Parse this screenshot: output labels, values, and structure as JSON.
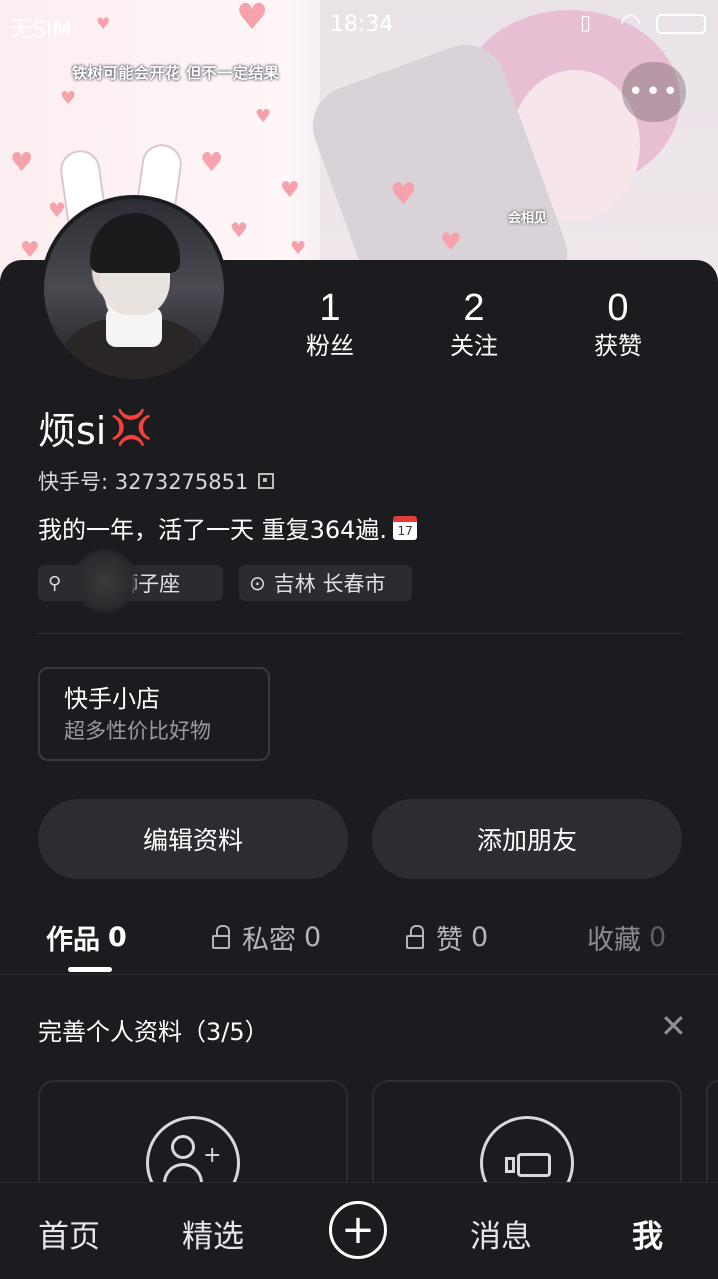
{
  "status_bar": {
    "carrier": "无SIM",
    "time": "18:34"
  },
  "banner": {
    "lyric": "铁树可能会开花 但不一定结果",
    "sticker_text": "会相见",
    "more_label": "•••"
  },
  "profile": {
    "stats": [
      {
        "num": "1",
        "label": "粉丝"
      },
      {
        "num": "2",
        "label": "关注"
      },
      {
        "num": "0",
        "label": "获赞"
      }
    ],
    "name": "烦si",
    "name_emoji": "💢",
    "id_label": "快手号: 3273275851",
    "bio": "我的一年，活了一天 重复364遍.",
    "bio_calendar_day": "17",
    "tags": [
      {
        "text": "狮子座"
      },
      {
        "text": "吉林 长春市"
      }
    ]
  },
  "shop": {
    "title": "快手小店",
    "subtitle": "超多性价比好物"
  },
  "buttons": {
    "edit": "编辑资料",
    "add_friend": "添加朋友"
  },
  "tabs": [
    {
      "label": "作品",
      "count": "0"
    },
    {
      "label": "私密",
      "count": "0"
    },
    {
      "label": "赞",
      "count": "0"
    },
    {
      "label": "收藏",
      "count": "0"
    }
  ],
  "complete_profile": {
    "title": "完善个人资料（3/5）"
  },
  "bottom_nav": [
    {
      "label": "首页"
    },
    {
      "label": "精选"
    },
    {
      "label": "消息"
    },
    {
      "label": "我"
    }
  ],
  "colors": {
    "background": "#1c1b20",
    "button": "#2d2c32",
    "accent_red": "#e43a3a"
  }
}
